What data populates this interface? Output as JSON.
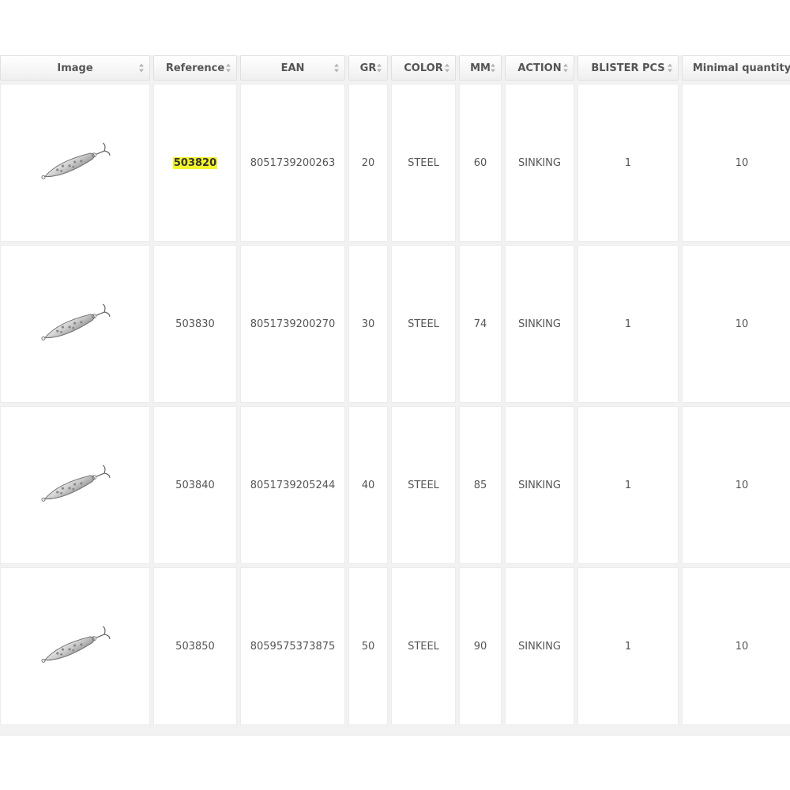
{
  "table": {
    "columns": [
      {
        "label": "Image",
        "key": "image"
      },
      {
        "label": "Reference",
        "key": "reference"
      },
      {
        "label": "EAN",
        "key": "ean"
      },
      {
        "label": "GR",
        "key": "gr"
      },
      {
        "label": "COLOR",
        "key": "color"
      },
      {
        "label": "MM",
        "key": "mm"
      },
      {
        "label": "ACTION",
        "key": "action"
      },
      {
        "label": "BLISTER PCS",
        "key": "blister"
      },
      {
        "label": "Minimal quantity",
        "key": "minqty"
      }
    ],
    "rows": [
      {
        "image": "steel-spoon-lure",
        "reference": "503820",
        "ean": "8051739200263",
        "gr": "20",
        "color": "STEEL",
        "mm": "60",
        "action": "SINKING",
        "blister": "1",
        "minqty": "10",
        "highlight": true
      },
      {
        "image": "steel-spoon-lure",
        "reference": "503830",
        "ean": "8051739200270",
        "gr": "30",
        "color": "STEEL",
        "mm": "74",
        "action": "SINKING",
        "blister": "1",
        "minqty": "10"
      },
      {
        "image": "steel-spoon-lure",
        "reference": "503840",
        "ean": "8051739205244",
        "gr": "40",
        "color": "STEEL",
        "mm": "85",
        "action": "SINKING",
        "blister": "1",
        "minqty": "10"
      },
      {
        "image": "steel-spoon-lure",
        "reference": "503850",
        "ean": "8059575373875",
        "gr": "50",
        "color": "STEEL",
        "mm": "90",
        "action": "SINKING",
        "blister": "1",
        "minqty": "10"
      }
    ]
  },
  "colors": {
    "highlight": "#f3f52a",
    "header_bg": "#efefef",
    "cell_bg": "#ffffff"
  }
}
